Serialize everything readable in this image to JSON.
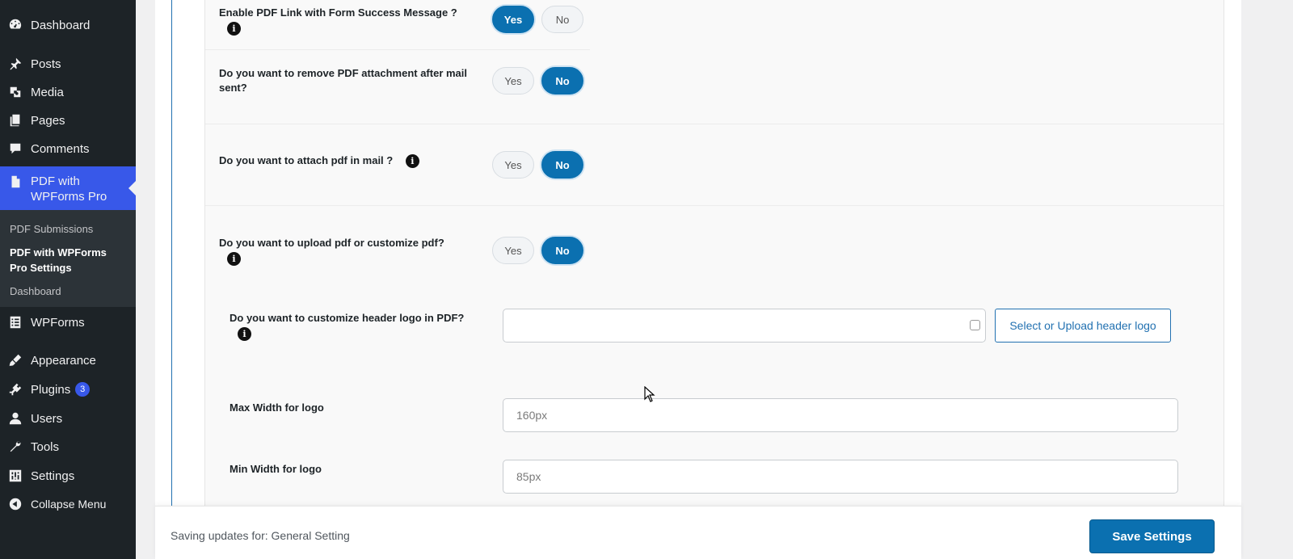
{
  "sidebar": {
    "items": [
      {
        "label": "Dashboard",
        "icon": "dashboard-icon"
      },
      {
        "label": "Posts",
        "icon": "pin-icon"
      },
      {
        "label": "Media",
        "icon": "media-icon"
      },
      {
        "label": "Pages",
        "icon": "pages-icon"
      },
      {
        "label": "Comments",
        "icon": "comments-icon"
      },
      {
        "label": "PDF with WPForms Pro",
        "icon": "document-icon",
        "active": true
      },
      {
        "label": "WPForms",
        "icon": "form-icon"
      },
      {
        "label": "Appearance",
        "icon": "brush-icon"
      },
      {
        "label": "Plugins",
        "icon": "plugin-icon",
        "badge": "3"
      },
      {
        "label": "Users",
        "icon": "user-icon"
      },
      {
        "label": "Tools",
        "icon": "wrench-icon"
      },
      {
        "label": "Settings",
        "icon": "settings-icon"
      },
      {
        "label": "Collapse Menu",
        "icon": "collapse-icon"
      }
    ],
    "submenu": [
      {
        "label": "PDF Submissions"
      },
      {
        "label": "PDF with WPForms Pro Settings",
        "current": true
      },
      {
        "label": "Dashboard"
      }
    ]
  },
  "settings": {
    "pdf_link": {
      "label": "Enable PDF Link with Form Success Message ?",
      "yes": "Yes",
      "no": "No",
      "selected": "Yes"
    },
    "remove_attachment": {
      "label": "Do you want to remove PDF attachment after mail sent?",
      "yes": "Yes",
      "no": "No",
      "selected": "No"
    },
    "attach_pdf": {
      "label": "Do you want to attach pdf in mail ?",
      "yes": "Yes",
      "no": "No",
      "selected": "No"
    },
    "upload_customize": {
      "label": "Do you want to upload pdf or customize pdf?",
      "yes": "Yes",
      "no": "No",
      "selected": "No"
    },
    "header_logo": {
      "label": "Do you want to customize header logo in PDF?",
      "value": "",
      "button": "Select or Upload header logo"
    },
    "max_width": {
      "label": "Max Width for logo",
      "placeholder": "160px"
    },
    "min_width": {
      "label": "Min Width for logo",
      "placeholder": "85px"
    }
  },
  "footer": {
    "saving_text": "Saving updates for: General Setting",
    "save_button": "Save Settings"
  },
  "colors": {
    "accent": "#0b70b0",
    "sidebar_bg": "#1d2327",
    "active_menu": "#3858e9"
  }
}
